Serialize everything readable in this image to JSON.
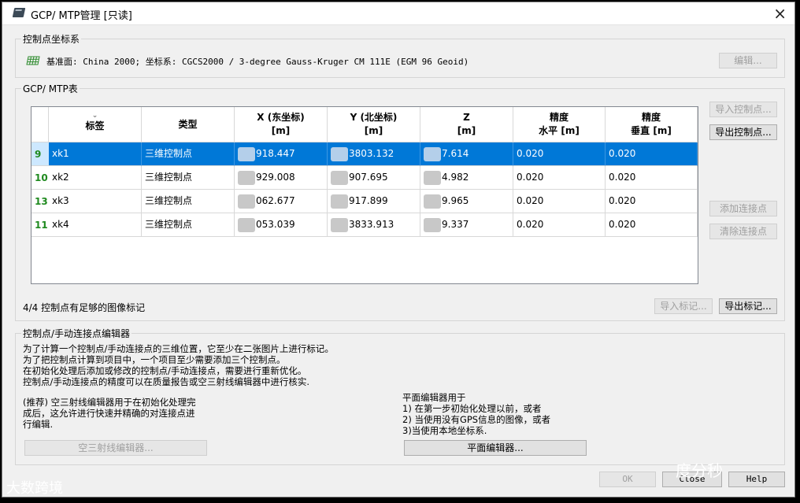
{
  "window": {
    "title": "GCP/ MTP管理 [只读]"
  },
  "crs": {
    "group_label": "控制点坐标系",
    "text": "基准面: China 2000; 坐标系: CGCS2000 / 3-degree Gauss-Kruger CM 111E (EGM 96 Geoid)",
    "edit_btn": "编辑..."
  },
  "gcp": {
    "group_label": "GCP/ MTP表",
    "columns": [
      {
        "line1": "标签",
        "line2": ""
      },
      {
        "line1": "类型",
        "line2": ""
      },
      {
        "line1": "X (东坐标)",
        "line2": "[m]"
      },
      {
        "line1": "Y (北坐标)",
        "line2": "[m]"
      },
      {
        "line1": "Z",
        "line2": "[m]"
      },
      {
        "line1": "精度",
        "line2": "水平 [m]"
      },
      {
        "line1": "精度",
        "line2": "垂直 [m]"
      }
    ],
    "rows": [
      {
        "num": "9",
        "label": "xk1",
        "type": "三维控制点",
        "x": "918.447",
        "y": "3803.132",
        "z": "7.614",
        "h": "0.020",
        "v": "0.020"
      },
      {
        "num": "10",
        "label": "xk2",
        "type": "三维控制点",
        "x": "929.008",
        "y": "907.695",
        "z": "4.982",
        "h": "0.020",
        "v": "0.020"
      },
      {
        "num": "13",
        "label": "xk3",
        "type": "三维控制点",
        "x": "062.677",
        "y": "917.899",
        "z": "9.965",
        "h": "0.020",
        "v": "0.020"
      },
      {
        "num": "11",
        "label": "xk4",
        "type": "三维控制点",
        "x": "053.039",
        "y": "3833.913",
        "z": "9.337",
        "h": "0.020",
        "v": "0.020"
      }
    ],
    "import_gcp": "导入控制点...",
    "export_gcp": "导出控制点...",
    "add_tie": "添加连接点",
    "clear_tie": "清除连接点",
    "status": "4/4 控制点有足够的图像标记",
    "import_marks": "导入标记...",
    "export_marks": "导出标记..."
  },
  "editor": {
    "group_label": "控制点/手动连接点编辑器",
    "desc": [
      "为了计算一个控制点/手动连接点的三维位置，它至少在二张图片上进行标记。",
      "为了把控制点计算到项目中，一个项目至少需要添加三个控制点。",
      "在初始化处理后添加或修改的控制点/手动连接点，需要进行重新优化。",
      "控制点/手动连接点的精度可以在质量报告或空三射线编辑器中进行核实."
    ],
    "ray_desc": [
      "(推荐) 空三射线编辑器用于在初始化处理完",
      "成后，这允许进行快速并精确的对连接点进",
      "行编辑."
    ],
    "ray_btn": "空三射线编辑器...",
    "plane_desc": [
      "平面编辑器用于",
      "1) 在第一步初始化处理以前，或者",
      "2) 当使用没有GPS信息的图像，或者",
      "3)当使用本地坐标系."
    ],
    "plane_btn": "平面编辑器..."
  },
  "footer": {
    "ok": "OK",
    "close": "Close",
    "help": "Help"
  },
  "watermarks": {
    "left": "大数跨境",
    "right": "度分秒"
  }
}
